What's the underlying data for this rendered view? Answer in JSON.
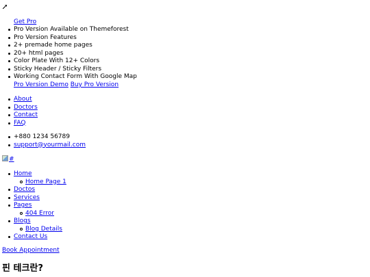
{
  "promo": {
    "toggle_icon": "expand-diagonal-icon",
    "get_pro_label": "Get Pro",
    "features": [
      "Pro Version Available on Themeforest",
      "Pro Version Features",
      "2+ premade home pages",
      "20+ html pages",
      "Color Plate With 12+ Colors",
      "Sticky Header / Sticky Filters",
      "Working Contact Form With Google Map"
    ],
    "demo_label": "Pro Version Demo",
    "buy_label": "Buy Pro Version"
  },
  "top_links": [
    "About",
    "Doctors",
    "Contact",
    "FAQ"
  ],
  "contact": {
    "phone": "+880 1234 56789",
    "email": "support@yourmail.com"
  },
  "logo": {
    "alt": "#"
  },
  "nav": {
    "home": "Home",
    "home_sub": "Home Page 1",
    "doctors": "Doctos",
    "services": "Services",
    "pages": "Pages",
    "pages_sub": "404 Error",
    "blogs": "Blogs",
    "blogs_sub": "Blog Details",
    "contact_us": "Contact Us"
  },
  "book_label": "Book Appointment",
  "heading": "핀 테크란?"
}
